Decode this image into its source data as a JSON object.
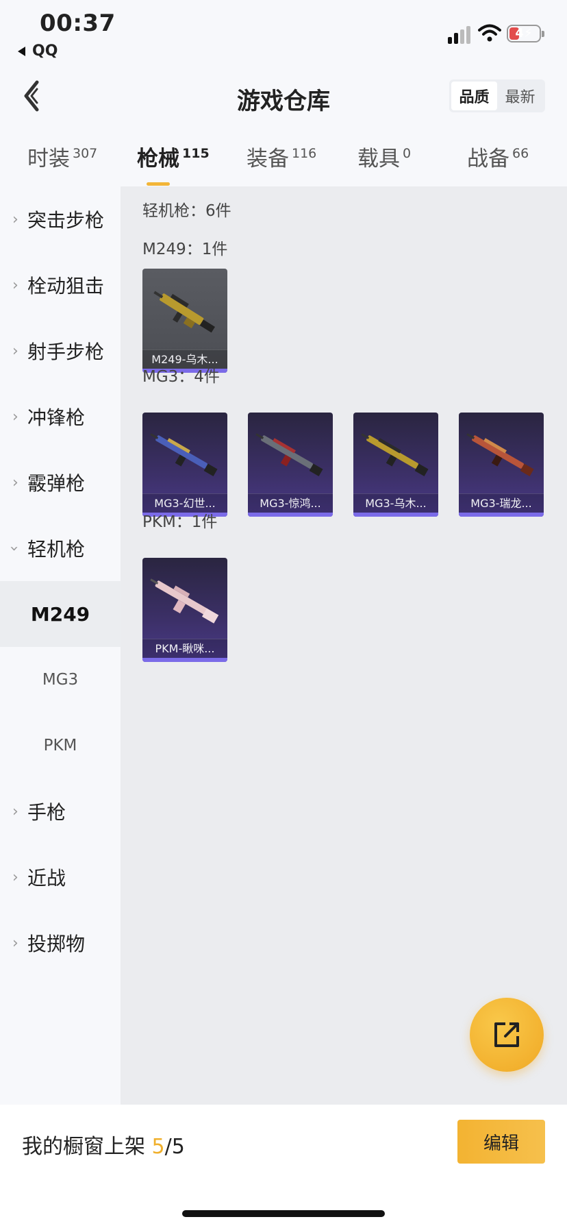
{
  "status_bar": {
    "time": "00:37",
    "back_app": "QQ",
    "battery": "4"
  },
  "header": {
    "title": "游戏仓库",
    "sort_options": [
      "品质",
      "最新"
    ]
  },
  "tabs": [
    {
      "label": "时装",
      "count": "307"
    },
    {
      "label": "枪械",
      "count": "115"
    },
    {
      "label": "装备",
      "count": "116"
    },
    {
      "label": "载具",
      "count": "0"
    },
    {
      "label": "战备",
      "count": "66"
    }
  ],
  "sidebar": {
    "categories": [
      "突击步枪",
      "栓动狙击",
      "射手步枪",
      "冲锋枪",
      "霰弹枪",
      "轻机枪",
      "手枪",
      "近战",
      "投掷物"
    ],
    "subitems": [
      "M249",
      "MG3",
      "PKM"
    ]
  },
  "content": {
    "summary": "轻机枪：6件",
    "groups": [
      {
        "title": "M249：1件",
        "items": [
          "M249-乌木..."
        ]
      },
      {
        "title": "MG3：4件",
        "items": [
          "MG3-幻世...",
          "MG3-惊鸿...",
          "MG3-乌木...",
          "MG3-瑞龙..."
        ]
      },
      {
        "title": "PKM：1件",
        "items": [
          "PKM-瞅咪..."
        ]
      }
    ]
  },
  "bottom": {
    "label": "我的橱窗上架 ",
    "count": "5",
    "total": "/5",
    "edit": "编辑"
  },
  "colors": {
    "accent": "#f2b538",
    "card_purple": "#3c3068",
    "card_strip": "#7b6be8"
  }
}
